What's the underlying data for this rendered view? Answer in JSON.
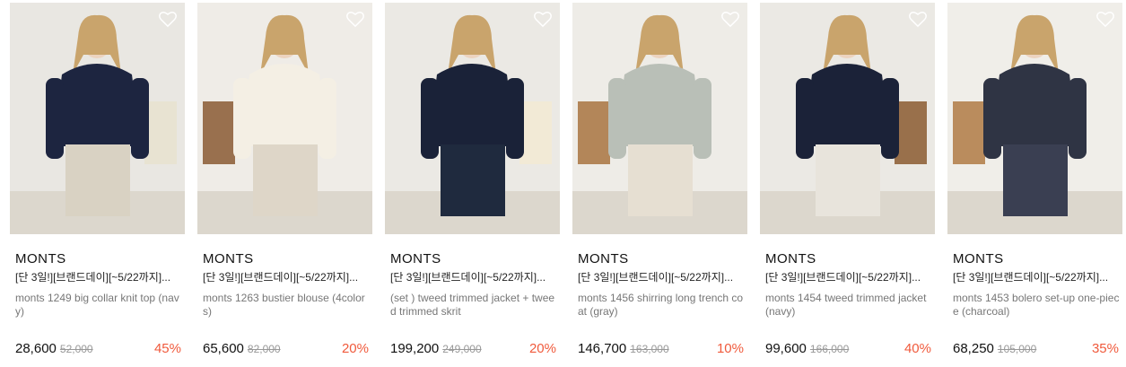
{
  "products": [
    {
      "brand": "MONTS",
      "promo": "[단 3일!][브랜드데이][~5/22까지]...",
      "name": "monts 1249 big collar knit top (navy)",
      "price": "28,600",
      "original_price": "52,000",
      "discount": "45%",
      "palette": {
        "bg": "#e9e7e2",
        "top": "#1d2540",
        "bottom": "#d9d2c3",
        "accent": "#e8e2cf"
      }
    },
    {
      "brand": "MONTS",
      "promo": "[단 3일!][브랜드데이][~5/22까지]...",
      "name": "monts 1263 bustier blouse (4colors)",
      "price": "65,600",
      "original_price": "82,000",
      "discount": "20%",
      "palette": {
        "bg": "#efece7",
        "top": "#f4efe4",
        "bottom": "#ded6c8",
        "accent": "#8a5b33"
      }
    },
    {
      "brand": "MONTS",
      "promo": "[단 3일!][브랜드데이][~5/22까지]...",
      "name": "(set ) tweed trimmed jacket + tweed trimmed skrit",
      "price": "199,200",
      "original_price": "249,000",
      "discount": "20%",
      "palette": {
        "bg": "#ebe9e4",
        "top": "#1a2238",
        "bottom": "#1f2a3e",
        "accent": "#f3ead3"
      }
    },
    {
      "brand": "MONTS",
      "promo": "[단 3일!][브랜드데이][~5/22까지]...",
      "name": "monts 1456 shirring long trench coat (gray)",
      "price": "146,700",
      "original_price": "163,000",
      "discount": "10%",
      "palette": {
        "bg": "#eeece7",
        "top": "#b9bfb7",
        "bottom": "#e6dfd2",
        "accent": "#a87440"
      }
    },
    {
      "brand": "MONTS",
      "promo": "[단 3일!][브랜드데이][~5/22까지]...",
      "name": "monts 1454 tweed trimmed jacket (navy)",
      "price": "99,600",
      "original_price": "166,000",
      "discount": "40%",
      "palette": {
        "bg": "#ebe9e4",
        "top": "#1b2238",
        "bottom": "#e8e4dc",
        "accent": "#8b5a30"
      }
    },
    {
      "brand": "MONTS",
      "promo": "[단 3일!][브랜드데이][~5/22까지]...",
      "name": "monts 1453 bolero set-up one-piece (charcoal)",
      "price": "68,250",
      "original_price": "105,000",
      "discount": "35%",
      "palette": {
        "bg": "#f0eee9",
        "top": "#2f3444",
        "bottom": "#3a3f52",
        "accent": "#b07a44"
      }
    }
  ]
}
